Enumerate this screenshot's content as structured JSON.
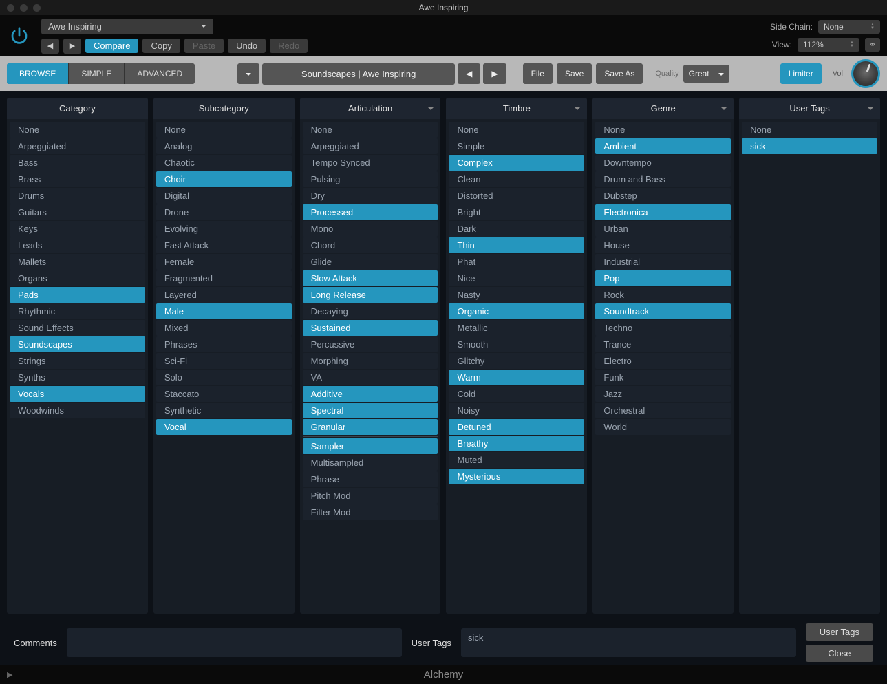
{
  "window": {
    "title": "Awe Inspiring"
  },
  "host": {
    "preset_name": "Awe Inspiring",
    "compare": "Compare",
    "copy": "Copy",
    "paste": "Paste",
    "undo": "Undo",
    "redo": "Redo",
    "side_chain_label": "Side Chain:",
    "side_chain_value": "None",
    "view_label": "View:",
    "view_value": "112%"
  },
  "toolbar": {
    "tabs": {
      "browse": "BROWSE",
      "simple": "SIMPLE",
      "advanced": "ADVANCED"
    },
    "preset_path": "Soundscapes | Awe Inspiring",
    "file": "File",
    "save": "Save",
    "save_as": "Save As",
    "quality_label": "Quality",
    "quality_value": "Great",
    "limiter": "Limiter",
    "vol": "Vol"
  },
  "columns": {
    "category": {
      "header": "Category",
      "items": [
        {
          "l": "None",
          "s": false
        },
        {
          "l": "Arpeggiated",
          "s": false
        },
        {
          "l": "Bass",
          "s": false
        },
        {
          "l": "Brass",
          "s": false
        },
        {
          "l": "Drums",
          "s": false
        },
        {
          "l": "Guitars",
          "s": false
        },
        {
          "l": "Keys",
          "s": false
        },
        {
          "l": "Leads",
          "s": false
        },
        {
          "l": "Mallets",
          "s": false
        },
        {
          "l": "Organs",
          "s": false
        },
        {
          "l": "Pads",
          "s": true
        },
        {
          "l": "Rhythmic",
          "s": false
        },
        {
          "l": "Sound Effects",
          "s": false
        },
        {
          "l": "Soundscapes",
          "s": true
        },
        {
          "l": "Strings",
          "s": false
        },
        {
          "l": "Synths",
          "s": false
        },
        {
          "l": "Vocals",
          "s": true
        },
        {
          "l": "Woodwinds",
          "s": false
        }
      ]
    },
    "subcategory": {
      "header": "Subcategory",
      "items": [
        {
          "l": "None",
          "s": false
        },
        {
          "l": "Analog",
          "s": false
        },
        {
          "l": "Chaotic",
          "s": false
        },
        {
          "l": "Choir",
          "s": true
        },
        {
          "l": "Digital",
          "s": false
        },
        {
          "l": "Drone",
          "s": false
        },
        {
          "l": "Evolving",
          "s": false
        },
        {
          "l": "Fast Attack",
          "s": false
        },
        {
          "l": "Female",
          "s": false
        },
        {
          "l": "Fragmented",
          "s": false
        },
        {
          "l": "Layered",
          "s": false
        },
        {
          "l": "Male",
          "s": true
        },
        {
          "l": "Mixed",
          "s": false
        },
        {
          "l": "Phrases",
          "s": false
        },
        {
          "l": "Sci-Fi",
          "s": false
        },
        {
          "l": "Solo",
          "s": false
        },
        {
          "l": "Staccato",
          "s": false
        },
        {
          "l": "Synthetic",
          "s": false
        },
        {
          "l": "Vocal",
          "s": true
        }
      ]
    },
    "articulation": {
      "header": "Articulation",
      "has_dropdown": true,
      "groups": [
        [
          {
            "l": "None",
            "s": false
          },
          {
            "l": "Arpeggiated",
            "s": false
          },
          {
            "l": "Tempo Synced",
            "s": false
          },
          {
            "l": "Pulsing",
            "s": false
          },
          {
            "l": "Dry",
            "s": false
          },
          {
            "l": "Processed",
            "s": true
          },
          {
            "l": "Mono",
            "s": false
          },
          {
            "l": "Chord",
            "s": false
          },
          {
            "l": "Glide",
            "s": false
          },
          {
            "l": "Slow Attack",
            "s": true
          },
          {
            "l": "Long Release",
            "s": true
          },
          {
            "l": "Decaying",
            "s": false
          },
          {
            "l": "Sustained",
            "s": true
          },
          {
            "l": "Percussive",
            "s": false
          },
          {
            "l": "Morphing",
            "s": false
          },
          {
            "l": "VA",
            "s": false
          },
          {
            "l": "Additive",
            "s": true
          },
          {
            "l": "Spectral",
            "s": true
          },
          {
            "l": "Granular",
            "s": true
          }
        ],
        [
          {
            "l": "Sampler",
            "s": true
          },
          {
            "l": "Multisampled",
            "s": false
          },
          {
            "l": "Phrase",
            "s": false
          },
          {
            "l": "Pitch Mod",
            "s": false
          },
          {
            "l": "Filter Mod",
            "s": false
          }
        ]
      ]
    },
    "timbre": {
      "header": "Timbre",
      "has_dropdown": true,
      "items": [
        {
          "l": "None",
          "s": false
        },
        {
          "l": "Simple",
          "s": false
        },
        {
          "l": "Complex",
          "s": true
        },
        {
          "l": "Clean",
          "s": false
        },
        {
          "l": "Distorted",
          "s": false
        },
        {
          "l": "Bright",
          "s": false
        },
        {
          "l": "Dark",
          "s": false
        },
        {
          "l": "Thin",
          "s": true
        },
        {
          "l": "Phat",
          "s": false
        },
        {
          "l": "Nice",
          "s": false
        },
        {
          "l": "Nasty",
          "s": false
        },
        {
          "l": "Organic",
          "s": true
        },
        {
          "l": "Metallic",
          "s": false
        },
        {
          "l": "Smooth",
          "s": false
        },
        {
          "l": "Glitchy",
          "s": false
        },
        {
          "l": "Warm",
          "s": true
        },
        {
          "l": "Cold",
          "s": false
        },
        {
          "l": "Noisy",
          "s": false
        },
        {
          "l": "Detuned",
          "s": true
        },
        {
          "l": "Breathy",
          "s": true
        },
        {
          "l": "Muted",
          "s": false
        },
        {
          "l": "Mysterious",
          "s": true
        }
      ]
    },
    "genre": {
      "header": "Genre",
      "has_dropdown": true,
      "items": [
        {
          "l": "None",
          "s": false
        },
        {
          "l": "Ambient",
          "s": true
        },
        {
          "l": "Downtempo",
          "s": false
        },
        {
          "l": "Drum and Bass",
          "s": false
        },
        {
          "l": "Dubstep",
          "s": false
        },
        {
          "l": "Electronica",
          "s": true
        },
        {
          "l": "Urban",
          "s": false
        },
        {
          "l": "House",
          "s": false
        },
        {
          "l": "Industrial",
          "s": false
        },
        {
          "l": "Pop",
          "s": true
        },
        {
          "l": "Rock",
          "s": false
        },
        {
          "l": "Soundtrack",
          "s": true
        },
        {
          "l": "Techno",
          "s": false
        },
        {
          "l": "Trance",
          "s": false
        },
        {
          "l": "Electro",
          "s": false
        },
        {
          "l": "Funk",
          "s": false
        },
        {
          "l": "Jazz",
          "s": false
        },
        {
          "l": "Orchestral",
          "s": false
        },
        {
          "l": "World",
          "s": false
        }
      ]
    },
    "usertags": {
      "header": "User Tags",
      "has_dropdown": true,
      "items": [
        {
          "l": "None",
          "s": false
        },
        {
          "l": "sick",
          "s": true
        }
      ]
    }
  },
  "bottom": {
    "comments_label": "Comments",
    "comments_value": "",
    "usertags_label": "User Tags",
    "usertags_value": "sick",
    "user_tags_btn": "User Tags",
    "close_btn": "Close"
  },
  "footer": {
    "name": "Alchemy"
  }
}
